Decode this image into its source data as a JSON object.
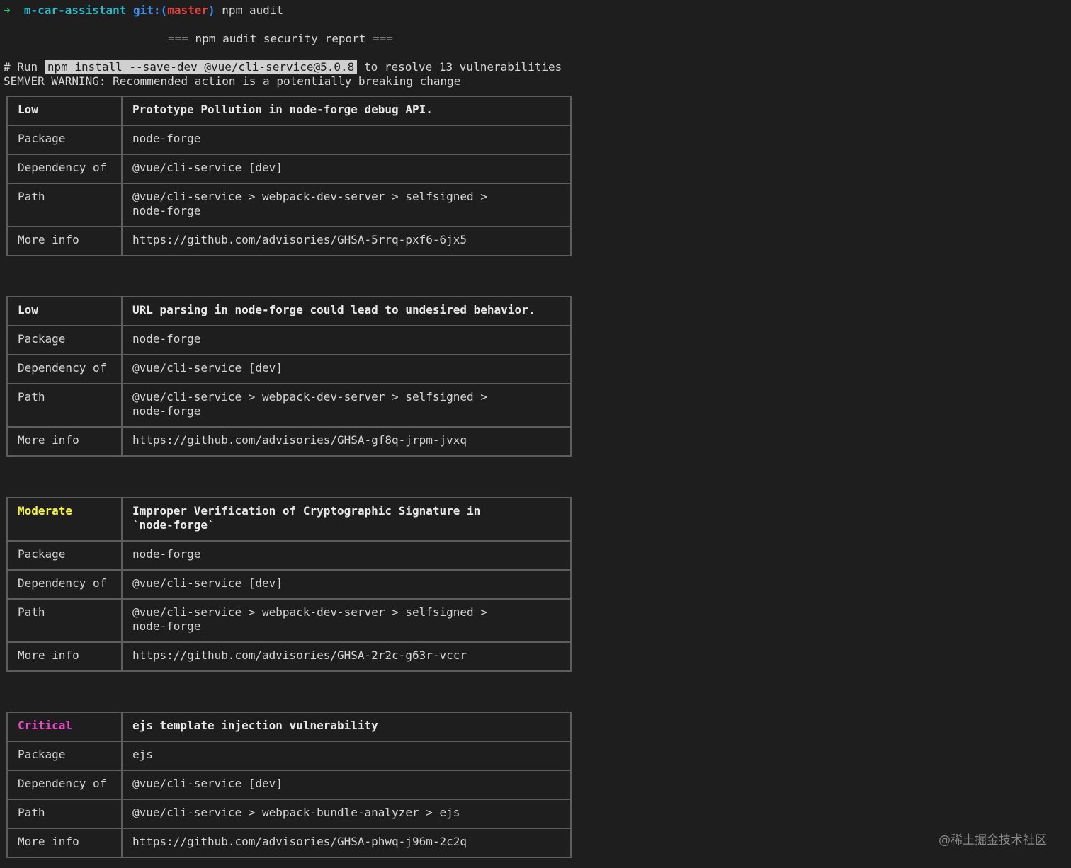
{
  "prompt": {
    "arrow": "➜",
    "directory": "m-car-assistant",
    "git_prefix": "git:(",
    "branch": "master",
    "git_suffix": ")",
    "command": "npm audit"
  },
  "report_title": "=== npm audit security report ===",
  "run_line": {
    "prefix": "# Run",
    "command": "npm install --save-dev @vue/cli-service@5.0.8",
    "suffix": "to resolve 13 vulnerabilities"
  },
  "semver_warning": "SEMVER WARNING: Recommended action is a potentially breaking change",
  "advisories": [
    {
      "severity": "Low",
      "title": "Prototype Pollution in node-forge debug API.",
      "labels": {
        "package": "Package",
        "dependency": "Dependency of",
        "path": "Path",
        "more_info": "More info"
      },
      "package": "node-forge",
      "dependency_of": "@vue/cli-service [dev]",
      "path": "@vue/cli-service > webpack-dev-server > selfsigned >\nnode-forge",
      "more_info": "https://github.com/advisories/GHSA-5rrq-pxf6-6jx5"
    },
    {
      "severity": "Low",
      "title": "URL parsing in node-forge could lead to undesired behavior.",
      "labels": {
        "package": "Package",
        "dependency": "Dependency of",
        "path": "Path",
        "more_info": "More info"
      },
      "package": "node-forge",
      "dependency_of": "@vue/cli-service [dev]",
      "path": "@vue/cli-service > webpack-dev-server > selfsigned >\nnode-forge",
      "more_info": "https://github.com/advisories/GHSA-gf8q-jrpm-jvxq"
    },
    {
      "severity": "Moderate",
      "title": "Improper Verification of Cryptographic Signature in\n`node-forge`",
      "labels": {
        "package": "Package",
        "dependency": "Dependency of",
        "path": "Path",
        "more_info": "More info"
      },
      "package": "node-forge",
      "dependency_of": "@vue/cli-service [dev]",
      "path": "@vue/cli-service > webpack-dev-server > selfsigned >\nnode-forge",
      "more_info": "https://github.com/advisories/GHSA-2r2c-g63r-vccr"
    },
    {
      "severity": "Critical",
      "title": "ejs template injection vulnerability",
      "labels": {
        "package": "Package",
        "dependency": "Dependency of",
        "path": "Path",
        "more_info": "More info"
      },
      "package": "ejs",
      "dependency_of": "@vue/cli-service [dev]",
      "path": "@vue/cli-service > webpack-bundle-analyzer > ejs",
      "more_info": "https://github.com/advisories/GHSA-phwq-j96m-2c2q"
    }
  ],
  "watermark": "@稀土掘金技术社区",
  "colors": {
    "background": "#1e1e1e",
    "low": "#e8e8e8",
    "moderate": "#f5f534",
    "critical": "#e848c8",
    "prompt_arrow": "#29c46a",
    "branch": "#e0443e"
  }
}
